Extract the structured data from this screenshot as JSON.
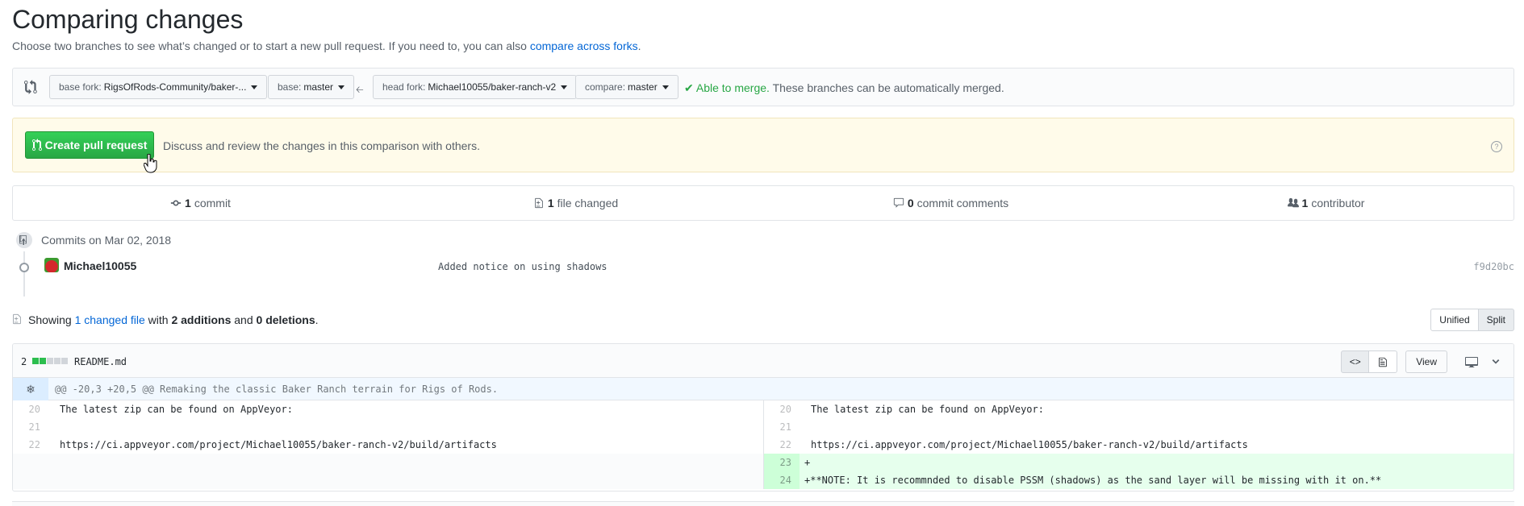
{
  "header": {
    "title": "Comparing changes",
    "subtitle_prefix": "Choose two branches to see what’s changed or to start a new pull request. If you need to, you can also",
    "subtitle_link": "compare across forks",
    "subtitle_suffix": "."
  },
  "range": {
    "base_fork_label": "base fork:",
    "base_fork_value": "RigsOfRods-Community/baker-...",
    "base_label": "base:",
    "base_value": "master",
    "head_fork_label": "head fork:",
    "head_fork_value": "Michael10055/baker-ranch-v2",
    "compare_label": "compare:",
    "compare_value": "master",
    "merge_ok": "Able to merge.",
    "merge_text": "These branches can be automatically merged."
  },
  "pr": {
    "button_label": "Create pull request",
    "description": "Discuss and review the changes in this comparison with others."
  },
  "summary": {
    "commits_count": "1",
    "commits_label": "commit",
    "files_count": "1",
    "files_label": "file changed",
    "comments_count": "0",
    "comments_label": "commit comments",
    "contributors_count": "1",
    "contributors_label": "contributor"
  },
  "commits": {
    "date_label": "Commits on Mar 02, 2018",
    "items": [
      {
        "author": "Michael10055",
        "message": "Added notice on using shadows",
        "sha": "f9d20bc"
      }
    ]
  },
  "diffstat": {
    "prefix": "Showing",
    "changed_link": "1 changed file",
    "with": "with",
    "additions": "2 additions",
    "and": "and",
    "deletions": "0 deletions",
    "end": ".",
    "unified_label": "Unified",
    "split_label": "Split"
  },
  "file": {
    "change_count": "2",
    "name": "README.md",
    "view_label": "View",
    "hunk_header": "@@ -20,3 +20,5 @@ Remaking the classic Baker Ranch terrain for Rigs of Rods.",
    "rows": [
      {
        "left_num": "20",
        "left_code": "The latest zip can be found on AppVeyor:",
        "right_num": "20",
        "right_code": "The latest zip can be found on AppVeyor:"
      },
      {
        "left_num": "21",
        "left_code": "",
        "right_num": "21",
        "right_code": ""
      },
      {
        "left_num": "22",
        "left_code": "https://ci.appveyor.com/project/Michael10055/baker-ranch-v2/build/artifacts",
        "right_num": "22",
        "right_code": "https://ci.appveyor.com/project/Michael10055/baker-ranch-v2/build/artifacts"
      },
      {
        "right_num": "23",
        "right_code": "+"
      },
      {
        "right_num": "24",
        "right_code": "+**NOTE: It is recommnded to disable PSSM (shadows) as the sand layer will be missing with it on.**"
      }
    ]
  },
  "colors": {
    "link": "#0366d6",
    "success": "#28a745",
    "addition_bg": "#e6ffed",
    "addition_num_bg": "#cdffd8",
    "hunk_bg": "#f1f8ff",
    "notice_bg": "#fffbea"
  },
  "icons": [
    "git-compare-icon",
    "arrow-left-icon",
    "check-icon",
    "git-pull-request-icon",
    "question-icon",
    "git-commit-icon",
    "file-diff-icon",
    "comment-icon",
    "people-icon",
    "repo-push-icon",
    "code-icon",
    "file-icon",
    "device-desktop-icon",
    "chevron-down-icon",
    "unfold-icon",
    "pointer-cursor-icon"
  ]
}
